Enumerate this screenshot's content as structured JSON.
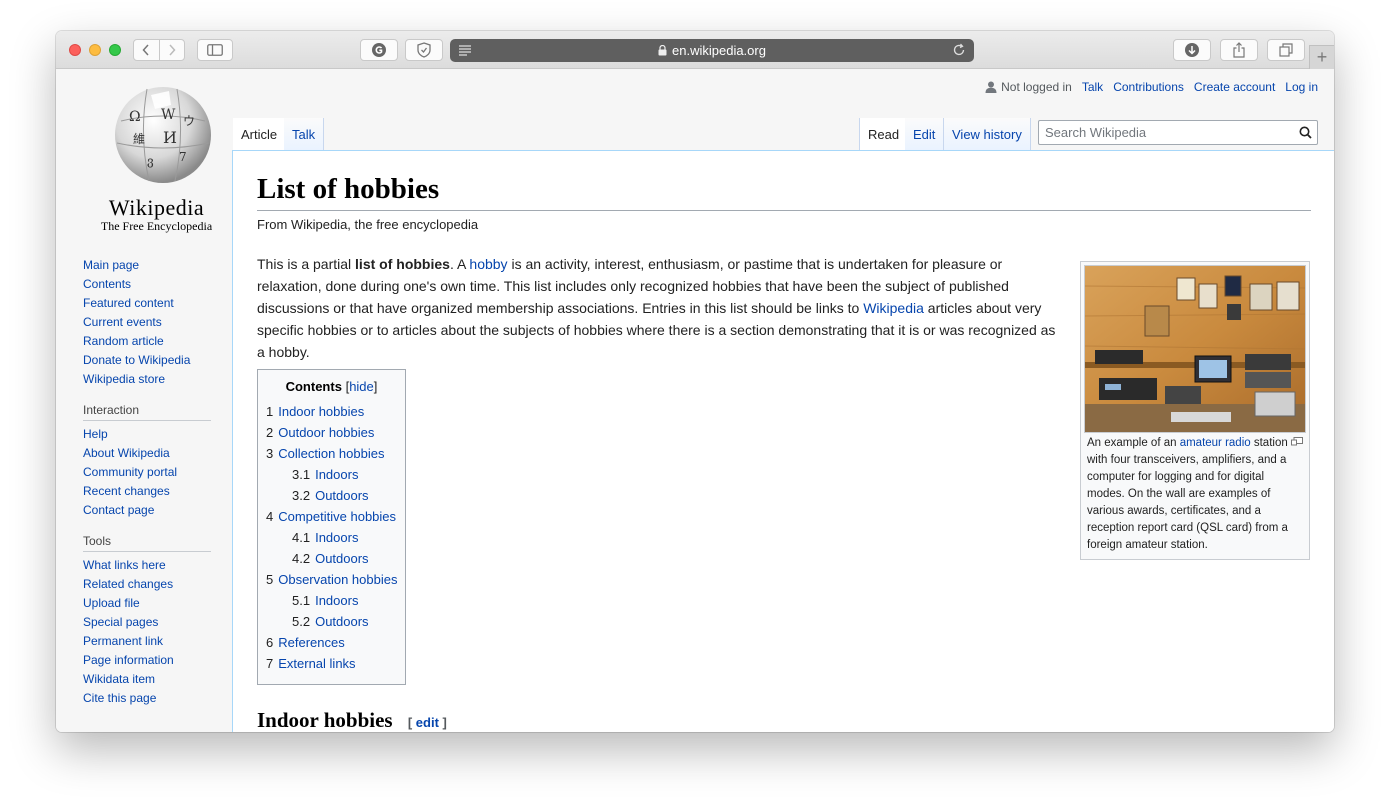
{
  "browser": {
    "url": "en.wikipedia.org"
  },
  "logo": {
    "wordmark": "Wikipedia",
    "tagline": "The Free Encyclopedia"
  },
  "personal": {
    "not_logged_in": "Not logged in",
    "links": [
      "Talk",
      "Contributions",
      "Create account",
      "Log in"
    ]
  },
  "tabs": {
    "left": [
      "Article",
      "Talk"
    ],
    "right": [
      "Read",
      "Edit",
      "View history"
    ],
    "search_placeholder": "Search Wikipedia"
  },
  "sidebar": {
    "navigation": [
      "Main page",
      "Contents",
      "Featured content",
      "Current events",
      "Random article",
      "Donate to Wikipedia",
      "Wikipedia store"
    ],
    "interaction_heading": "Interaction",
    "interaction": [
      "Help",
      "About Wikipedia",
      "Community portal",
      "Recent changes",
      "Contact page"
    ],
    "tools_heading": "Tools",
    "tools": [
      "What links here",
      "Related changes",
      "Upload file",
      "Special pages",
      "Permanent link",
      "Page information",
      "Wikidata item",
      "Cite this page"
    ]
  },
  "article": {
    "title": "List of hobbies",
    "sitesub": "From Wikipedia, the free encyclopedia",
    "intro": {
      "p1": "This is a partial ",
      "bold": "list of hobbies",
      "p2": ". A ",
      "link_hobby": "hobby",
      "p3": " is an activity, interest, enthusiasm, or pastime that is undertaken for pleasure or relaxation, done during one's own time. This list includes only recognized hobbies that have been the subject of published discussions or that have organized membership associations. Entries in this list should be links to ",
      "link_wikipedia": "Wikipedia",
      "p4": " articles about very specific hobbies or to articles about the subjects of hobbies where there is a section demonstrating that it is or was recognized as a hobby."
    },
    "toc": {
      "title": "Contents",
      "hide": "hide",
      "items": [
        {
          "num": "1",
          "label": "Indoor hobbies"
        },
        {
          "num": "2",
          "label": "Outdoor hobbies"
        },
        {
          "num": "3",
          "label": "Collection hobbies"
        },
        {
          "num": "3.1",
          "label": "Indoors"
        },
        {
          "num": "3.2",
          "label": "Outdoors"
        },
        {
          "num": "4",
          "label": "Competitive hobbies"
        },
        {
          "num": "4.1",
          "label": "Indoors"
        },
        {
          "num": "4.2",
          "label": "Outdoors"
        },
        {
          "num": "5",
          "label": "Observation hobbies"
        },
        {
          "num": "5.1",
          "label": "Indoors"
        },
        {
          "num": "5.2",
          "label": "Outdoors"
        },
        {
          "num": "6",
          "label": "References"
        },
        {
          "num": "7",
          "label": "External links"
        }
      ]
    },
    "thumb": {
      "caption_pre": "An example of an ",
      "caption_link": "amateur radio",
      "caption_post": " station with four transceivers, amplifiers, and a computer for logging and for digital modes. On the wall are examples of various awards, certificates, and a reception report card (QSL card) from a foreign amateur station."
    },
    "section1": {
      "heading": "Indoor hobbies",
      "edit": "edit"
    }
  },
  "colors": {
    "link": "#0645ad",
    "border_blue": "#a7d7f9",
    "text": "#222222"
  }
}
